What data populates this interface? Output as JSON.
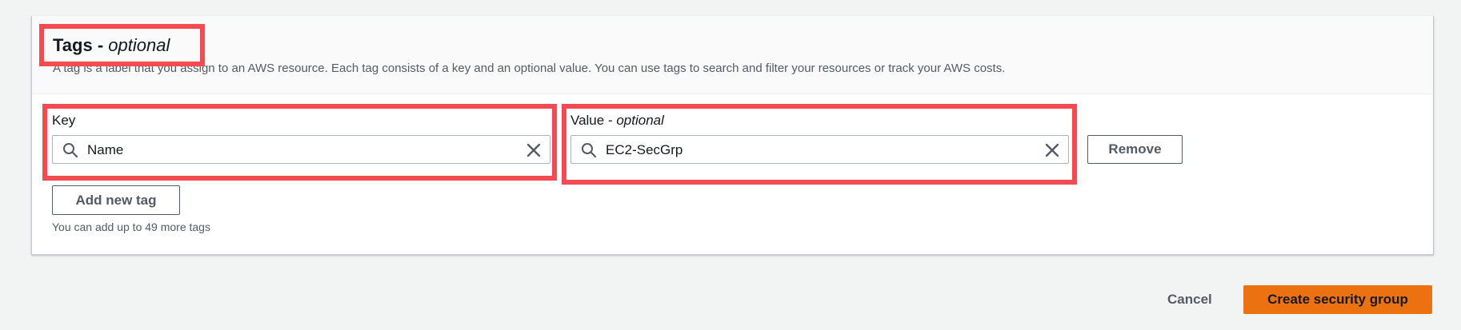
{
  "tags_section": {
    "title": "Tags - ",
    "title_optional": "optional",
    "description": "A tag is a label that you assign to an AWS resource. Each tag consists of a key and an optional value. You can use tags to search and filter your resources or track your AWS costs.",
    "key_label": "Key",
    "key_value": "Name",
    "value_label": "Value - ",
    "value_label_optional": "optional",
    "value_value": "EC2-SecGrp",
    "remove_label": "Remove",
    "add_tag_label": "Add new tag",
    "hint": "You can add up to 49 more tags"
  },
  "footer": {
    "cancel_label": "Cancel",
    "create_label": "Create security group"
  },
  "colors": {
    "highlight": "#f44b53",
    "primary": "#ec7211",
    "background": "#f2f3f3"
  },
  "icons": {
    "search": "search-icon",
    "clear": "close-icon"
  }
}
